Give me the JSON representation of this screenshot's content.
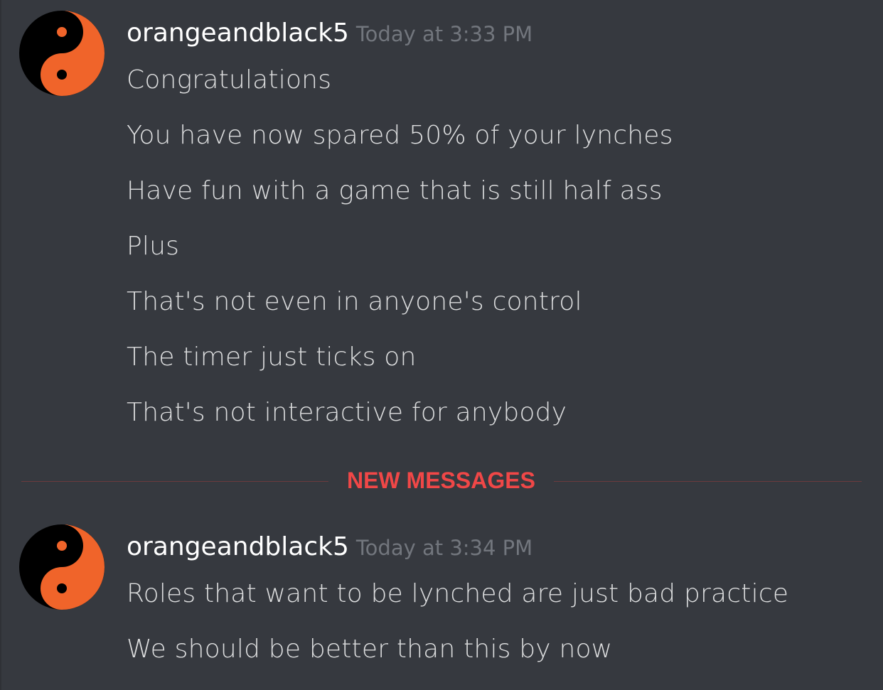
{
  "colors": {
    "background": "#36393f",
    "username": "#ffffff",
    "timestamp": "#72767d",
    "message_text": "#dcddde",
    "new_messages_accent": "#f04747",
    "avatar_orange": "#f0642a",
    "avatar_black": "#000000"
  },
  "messages": [
    {
      "avatar_icon": "yin-yang-avatar-icon",
      "username": "orangeandblack5",
      "timestamp": "Today at 3:33 PM",
      "lines": [
        "Congratulations",
        "You have now spared 50% of your lynches",
        "Have fun with a game that is still half ass",
        "Plus",
        "That's not even in anyone's control",
        "The timer just ticks on",
        "That's not interactive for anybody"
      ]
    },
    {
      "avatar_icon": "yin-yang-avatar-icon",
      "username": "orangeandblack5",
      "timestamp": "Today at 3:34 PM",
      "lines": [
        "Roles that want to be lynched are just bad practice",
        "We should be better than this by now"
      ]
    }
  ],
  "divider": {
    "label": "NEW MESSAGES"
  }
}
